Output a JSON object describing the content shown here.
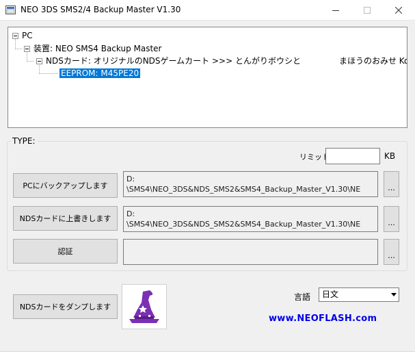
{
  "window": {
    "title": "NEO 3DS SMS2/4 Backup Master V1.30"
  },
  "tree": {
    "root": "PC",
    "device": "装置:  NEO SMS4 Backup Master",
    "card_prefix": "NDSカード:  オリジナルのNDSゲームカート >>> とんがりボウシと",
    "card_suffix": "まほうのおみせ Konami Digital E",
    "eeprom": "EEPROM:  M45PE20"
  },
  "type_group": {
    "label": "TYPE:",
    "limit_label": "リミット",
    "limit_value": "",
    "kb_label": "KB"
  },
  "rows": [
    {
      "button": "PCにバックアップします",
      "path_line1": "D:",
      "path_line2": "\\SMS4\\NEO_3DS&NDS_SMS2&SMS4_Backup_Master_V1.30\\NE",
      "browse": "..."
    },
    {
      "button": "NDSカードに上書きします",
      "path_line1": "D:",
      "path_line2": "\\SMS4\\NEO_3DS&NDS_SMS2&SMS4_Backup_Master_V1.30\\NE",
      "browse": "..."
    },
    {
      "button": "認証",
      "path_line1": "",
      "path_line2": "",
      "browse": "..."
    }
  ],
  "dump_button": "NDSカードをダンプします",
  "language": {
    "label": "言語",
    "selected": "日文"
  },
  "website": "www.NEOFLASH.com",
  "icons": {
    "app": "app-icon",
    "mascot": "wizard-hat-icon"
  },
  "colors": {
    "selection": "#0078d7",
    "link": "#0000ee",
    "wizard": "#7b2fb5"
  }
}
